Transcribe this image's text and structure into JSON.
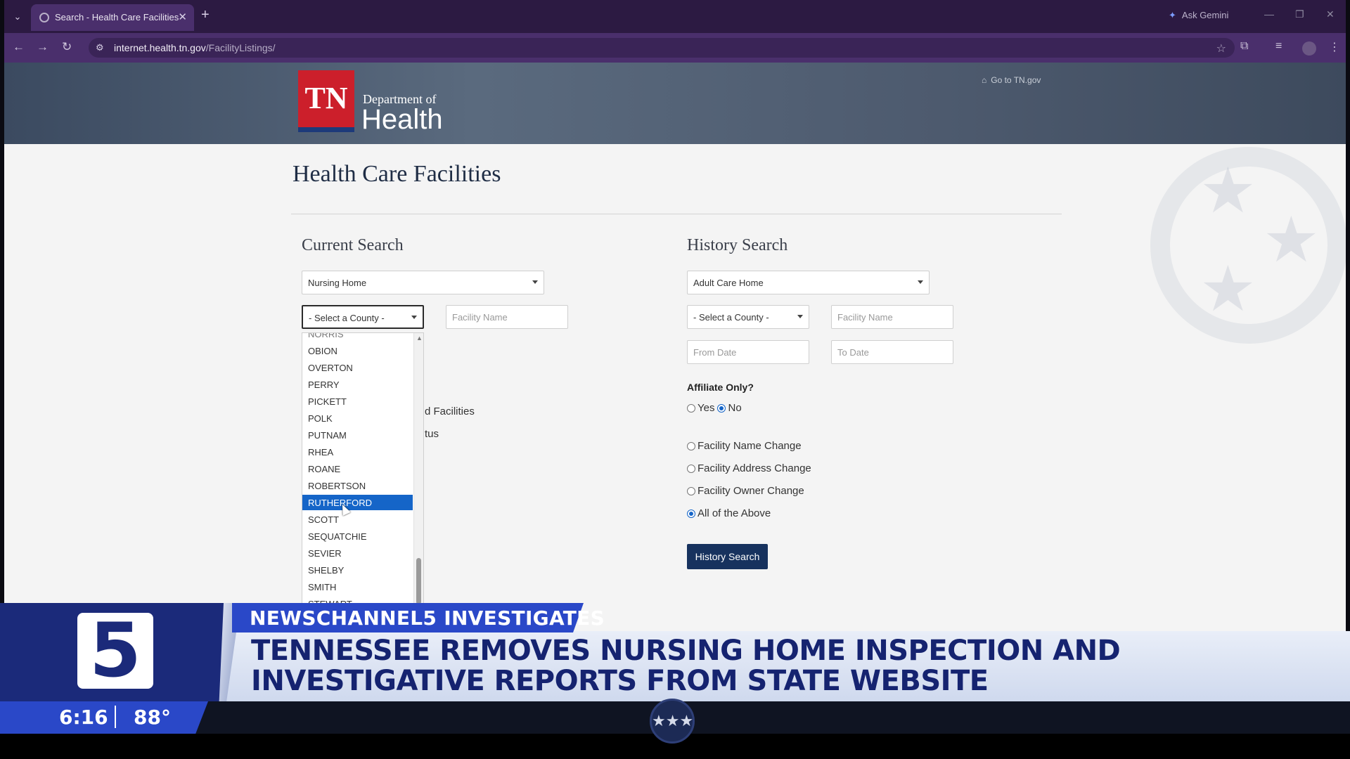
{
  "browser": {
    "tab_title": "Search - Health Care Facilities",
    "url_host": "internet.health.tn.gov",
    "url_path": "/FacilityListings/",
    "gemini_label": "Ask Gemini"
  },
  "header": {
    "logo_text": "TN",
    "dept_of": "Department of",
    "dept_name": "Health",
    "goto_link": "Go to TN.gov"
  },
  "page": {
    "title": "Health Care Facilities"
  },
  "current_search": {
    "heading": "Current Search",
    "facility_type": "Nursing Home",
    "county_select": "- Select a County -",
    "facility_name_placeholder": "Facility Name",
    "partial_text_1": "d Facilities",
    "partial_text_2": "tus",
    "county_peek": "NORRIS",
    "county_options": [
      "OBION",
      "OVERTON",
      "PERRY",
      "PICKETT",
      "POLK",
      "PUTNAM",
      "RHEA",
      "ROANE",
      "ROBERTSON",
      "RUTHERFORD",
      "SCOTT",
      "SEQUATCHIE",
      "SEVIER",
      "SHELBY",
      "SMITH",
      "STEWART"
    ],
    "highlighted_option": "RUTHERFORD"
  },
  "history_search": {
    "heading": "History Search",
    "facility_type": "Adult Care Home",
    "county_select": "- Select a County -",
    "facility_name_placeholder": "Facility Name",
    "from_date_placeholder": "From Date",
    "to_date_placeholder": "To Date",
    "affiliate_label": "Affiliate Only?",
    "affiliate_yes": "Yes",
    "affiliate_no": "No",
    "affiliate_selected": "No",
    "change_options": [
      "Facility Name Change",
      "Facility Address Change",
      "Facility Owner Change",
      "All of the Above"
    ],
    "change_selected": "All of the Above",
    "button_label": "History Search"
  },
  "news": {
    "channel_number": "5",
    "kicker": "NEWSCHANNEL5 INVESTIGATES",
    "headline_line1": "TENNESSEE REMOVES NURSING HOME INSPECTION AND",
    "headline_line2": "INVESTIGATIVE REPORTS FROM STATE WEBSITE",
    "time": "6:16",
    "temperature": "88°"
  },
  "colors": {
    "browser_frame": "#4a2f6c",
    "tn_red": "#cc1f2b",
    "highlight_blue": "#1565c8",
    "button_navy": "#17325e",
    "news_blue": "#2a48c8",
    "news_navy": "#1b2a7a"
  }
}
